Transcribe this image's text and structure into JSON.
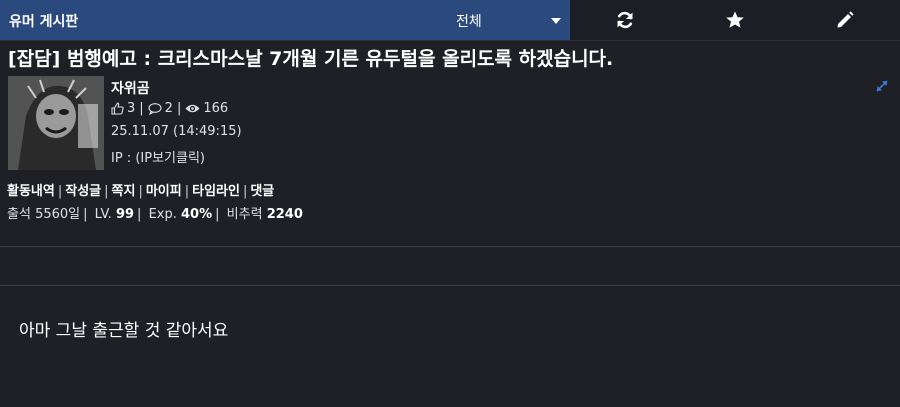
{
  "header": {
    "board_title": "유머 게시판",
    "filter_value": "전체",
    "icons": [
      "refresh-icon",
      "star-icon",
      "pencil-icon"
    ]
  },
  "post": {
    "title": "[잡담] 범행예고 : 크리스마스날 7개월 기른 유두털을 올리도록 하겠습니다.",
    "author": "자위곰",
    "likes": "3",
    "comments": "2",
    "views": "166",
    "date": "25.11.07 (14:49:15)",
    "ip_label": "IP : ",
    "ip_link": "(IP보기클릭)",
    "body": "아마 그날 출근할 것 같아서요"
  },
  "user_menu": {
    "items": [
      "활동내역",
      "작성글",
      "쪽지",
      "마이피",
      "타임라인",
      "댓글"
    ]
  },
  "user_info": {
    "attendance_label": "출석",
    "attendance_value": "5560일",
    "level_label": "LV.",
    "level_value": "99",
    "exp_label": "Exp.",
    "exp_value": "40%",
    "recommend_label": "비추력",
    "recommend_value": "2240"
  },
  "colors": {
    "background": "#1e2026",
    "header_accent": "#2a4a7e",
    "link_blue": "#3a7bd5"
  }
}
